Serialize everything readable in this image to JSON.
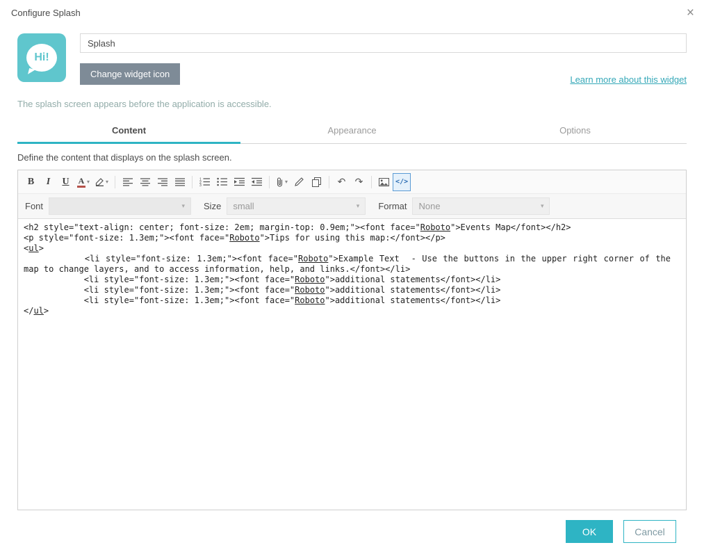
{
  "dialog": {
    "title": "Configure Splash",
    "close_icon": "×"
  },
  "widget": {
    "icon_text": "Hi!",
    "name_value": "Splash",
    "change_icon_button": "Change widget icon",
    "learn_more_link": "Learn more about this widget",
    "description": "The splash screen appears before the application is accessible."
  },
  "tabs": {
    "content": "Content",
    "appearance": "Appearance",
    "options": "Options"
  },
  "content_panel": {
    "instruction": "Define the content that displays on the splash screen."
  },
  "editor": {
    "toolbar": {
      "bold": "B",
      "italic": "I",
      "underline": "U",
      "font_color": "A",
      "undo": "↶",
      "redo": "↷",
      "source": "</>",
      "caret": "▾",
      "icon_names": [
        "bold",
        "italic",
        "underline",
        "font-color",
        "highlight",
        "align-left",
        "align-center",
        "align-right",
        "align-justify",
        "ordered-list",
        "unordered-list",
        "indent",
        "outdent",
        "attach",
        "format-paint",
        "copy",
        "undo",
        "redo",
        "image",
        "html-source"
      ],
      "active_icon": "html-source"
    },
    "format_bar": {
      "font_label": "Font",
      "font_value": "",
      "size_label": "Size",
      "size_value": "small",
      "format_label": "Format",
      "format_value": "None"
    },
    "underline_words": "Roboto,ul",
    "code": "<h2 style=\"text-align: center; font-size: 2em; margin-top: 0.9em;\"><font face=\"Roboto\">Events Map</font></h2>\n<p style=\"font-size: 1.3em;\"><font face=\"Roboto\">Tips for using this map:</font></p>\n<ul>\n\t<li style=\"font-size: 1.3em;\"><font face=\"Roboto\">Example Text  - Use the buttons in the upper right corner of the map to change layers, and to access information, help, and links.</font></li>\n\t<li style=\"font-size: 1.3em;\"><font face=\"Roboto\">additional statements</font></li>\n\t<li style=\"font-size: 1.3em;\"><font face=\"Roboto\">additional statements</font></li>\n\t<li style=\"font-size: 1.3em;\"><font face=\"Roboto\">additional statements</font></li>\n</ul>"
  },
  "footer": {
    "ok": "OK",
    "cancel": "Cancel"
  },
  "colors": {
    "accent_teal": "#2eb4c4",
    "widget_icon_teal": "#5fc6cd",
    "change_icon_gray": "#7e8b97",
    "link_teal": "#35a8b8",
    "description_teal_gray": "#92aca9",
    "source_active_blue": "#5b9bd5"
  }
}
